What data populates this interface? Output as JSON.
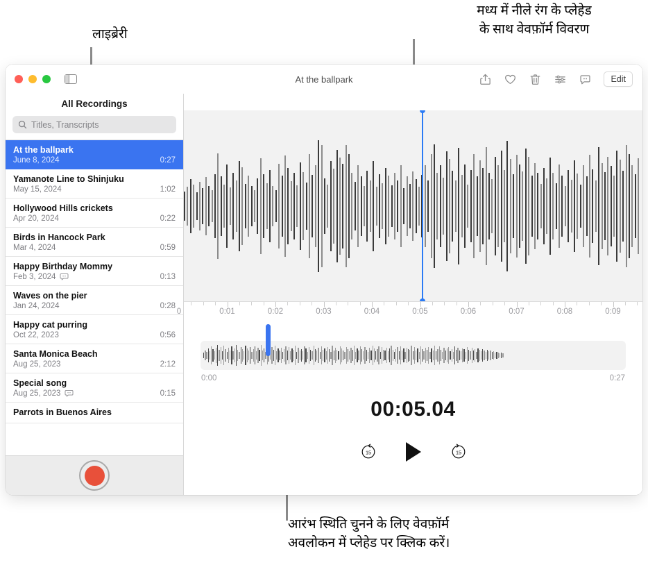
{
  "annotations": {
    "library": "लाइब्रेरी",
    "waveform_detail": "मध्य में नीले रंग के प्लेहेड\nके साथ वेवफ़ॉर्म विवरण",
    "overview_hint": "आरंभ स्थिति चुनने के लिए वेवफ़ॉर्म\nअवलोकन में प्लेहेड पर क्लिक करें।"
  },
  "window": {
    "title": "At the ballpark"
  },
  "toolbar": {
    "icons": [
      {
        "name": "share-icon",
        "label": "Share"
      },
      {
        "name": "favorite-icon",
        "label": "Favorite"
      },
      {
        "name": "trash-icon",
        "label": "Delete"
      },
      {
        "name": "enhance-icon",
        "label": "Audio settings"
      },
      {
        "name": "transcript-icon",
        "label": "Transcript"
      }
    ],
    "edit_label": "Edit"
  },
  "sidebar": {
    "title": "All Recordings",
    "search": {
      "placeholder": "Titles, Transcripts",
      "value": "",
      "icon": "search-icon"
    },
    "record_button": "record-button",
    "recordings": [
      {
        "title": "At the ballpark",
        "date": "June 8, 2024",
        "duration": "0:27",
        "selected": true,
        "transcript": false
      },
      {
        "title": "Yamanote Line to Shinjuku",
        "date": "May 15, 2024",
        "duration": "1:02",
        "selected": false,
        "transcript": false
      },
      {
        "title": "Hollywood Hills crickets",
        "date": "Apr 20, 2024",
        "duration": "0:22",
        "selected": false,
        "transcript": false
      },
      {
        "title": "Birds in Hancock Park",
        "date": "Mar 4, 2024",
        "duration": "0:59",
        "selected": false,
        "transcript": false
      },
      {
        "title": "Happy Birthday Mommy",
        "date": "Feb 3, 2024",
        "duration": "0:13",
        "selected": false,
        "transcript": true
      },
      {
        "title": "Waves on the pier",
        "date": "Jan 24, 2024",
        "duration": "0:28",
        "selected": false,
        "transcript": false
      },
      {
        "title": "Happy cat purring",
        "date": "Oct 22, 2023",
        "duration": "0:56",
        "selected": false,
        "transcript": false
      },
      {
        "title": "Santa Monica Beach",
        "date": "Aug 25, 2023",
        "duration": "2:12",
        "selected": false,
        "transcript": false
      },
      {
        "title": "Special song",
        "date": "Aug 25, 2023",
        "duration": "0:15",
        "selected": false,
        "transcript": true
      },
      {
        "title": "Parrots in Buenos Aires",
        "date": "",
        "duration": "",
        "selected": false,
        "transcript": false
      }
    ]
  },
  "detail": {
    "ruler_labels": [
      "0",
      "0:01",
      "0:02",
      "0:03",
      "0:04",
      "0:05",
      "0:06",
      "0:07",
      "0:08",
      "0:09"
    ],
    "overview_start": "0:00",
    "overview_end": "0:27",
    "timecode": "00:05.04",
    "transport": {
      "skip_back_label": "15",
      "play_label": "Play",
      "skip_forward_label": "15"
    },
    "playhead_position_seconds": 5.04
  },
  "colors": {
    "accent_blue": "#3a74f0",
    "playhead_blue": "#2b7bf5",
    "record_red": "#e8503a",
    "panel_gray": "#f2f2f2"
  },
  "waveform_detail_bars": [
    42,
    56,
    78,
    62,
    40,
    70,
    52,
    84,
    58,
    46,
    92,
    152,
    86,
    62,
    120,
    54,
    96,
    74,
    130,
    112,
    64,
    88,
    58,
    46,
    80,
    138,
    92,
    66,
    104,
    58,
    46,
    122,
    88,
    146,
    110,
    72,
    96,
    60,
    126,
    98,
    68,
    150,
    90,
    118,
    190,
    176,
    80,
    62,
    130,
    108,
    162,
    140,
    122,
    176,
    150,
    96,
    70,
    118,
    86,
    58,
    102,
    74,
    130,
    56,
    92,
    66,
    110,
    88,
    60,
    96,
    74,
    118,
    52,
    86,
    64,
    100,
    78,
    56,
    90,
    118,
    74,
    150,
    178,
    96,
    118,
    82,
    158,
    136,
    102,
    74,
    168,
    90,
    120,
    62,
    104,
    150,
    86,
    132,
    110,
    170,
    96,
    78,
    142,
    118,
    160,
    104,
    188,
    136,
    92,
    148,
    120,
    100,
    166,
    142,
    88,
    124,
    96,
    64,
    110,
    80,
    140,
    96,
    66,
    120,
    88,
    58,
    104,
    76,
    132,
    94,
    62,
    118,
    86,
    148,
    106,
    74,
    170,
    124,
    98,
    142,
    116,
    88,
    160,
    134,
    102,
    176,
    150,
    118,
    92,
    138
  ],
  "waveform_overview_bars": [
    8,
    14,
    10,
    20,
    12,
    26,
    18,
    12,
    22,
    30,
    16,
    24,
    12,
    28,
    18,
    10,
    22,
    14,
    26,
    12,
    20,
    30,
    16,
    10,
    24,
    18,
    12,
    28,
    20,
    14,
    24,
    10,
    18,
    26,
    12,
    22,
    16,
    30,
    14,
    20,
    10,
    26,
    18,
    12,
    24,
    16,
    28,
    12,
    20,
    14,
    22,
    10,
    18,
    26,
    14,
    24,
    12,
    20,
    16,
    28,
    10,
    22,
    14,
    18,
    12,
    26,
    20,
    10,
    24,
    16,
    12,
    28,
    18,
    14,
    22,
    10,
    26,
    16,
    20,
    12,
    24,
    18,
    10,
    28,
    14,
    22,
    16,
    12,
    26,
    20,
    14,
    10,
    24,
    18,
    12,
    22,
    16,
    28,
    10,
    20,
    14,
    26,
    18,
    12,
    24,
    16,
    10,
    22,
    14,
    28,
    20,
    12,
    18,
    26,
    10,
    24,
    16,
    14,
    22,
    12,
    20,
    28,
    16,
    10,
    18,
    24,
    12,
    26,
    14,
    20,
    10,
    22,
    18,
    16,
    28,
    12,
    24,
    14,
    20,
    10,
    26,
    18,
    12,
    22,
    16,
    24,
    10,
    20,
    14,
    28,
    12,
    18,
    26,
    16,
    10,
    22,
    14,
    20,
    24,
    12,
    18,
    10,
    26,
    16,
    22,
    14,
    12,
    20,
    18,
    10,
    24,
    16,
    12,
    22,
    14,
    18,
    10,
    20,
    16,
    12,
    18,
    14,
    10,
    16,
    12,
    14,
    10,
    12,
    8,
    10,
    8,
    6,
    8,
    6
  ]
}
